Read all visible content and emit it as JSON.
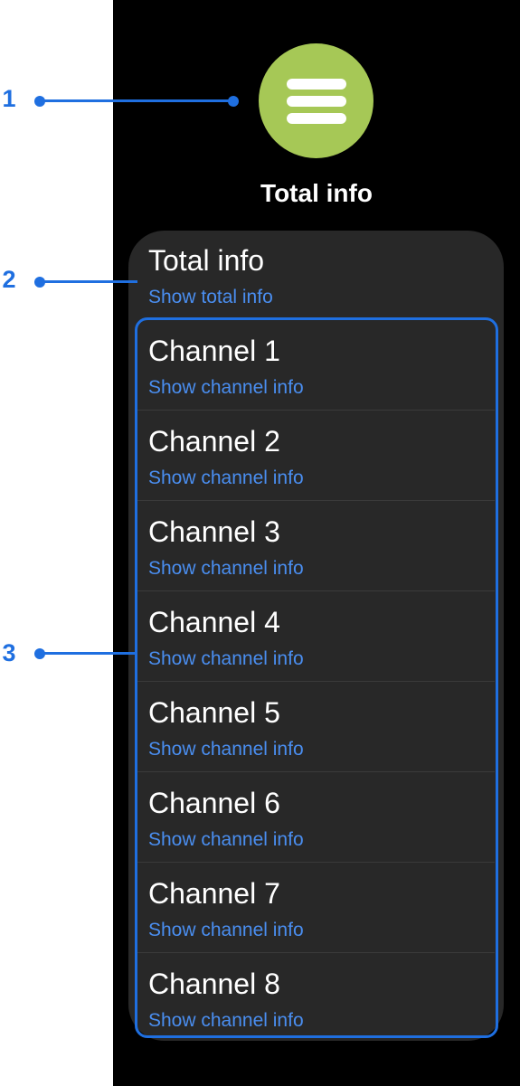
{
  "header": {
    "app_icon": "menu-icon",
    "app_icon_color": "#a6c856",
    "title": "Total info"
  },
  "list": {
    "total": {
      "title": "Total info",
      "subtitle": "Show total info"
    },
    "channels": [
      {
        "title": "Channel 1",
        "subtitle": "Show channel info"
      },
      {
        "title": "Channel 2",
        "subtitle": "Show channel info"
      },
      {
        "title": "Channel 3",
        "subtitle": "Show channel info"
      },
      {
        "title": "Channel 4",
        "subtitle": "Show channel info"
      },
      {
        "title": "Channel 5",
        "subtitle": "Show channel info"
      },
      {
        "title": "Channel 6",
        "subtitle": "Show channel info"
      },
      {
        "title": "Channel 7",
        "subtitle": "Show channel info"
      },
      {
        "title": "Channel 8",
        "subtitle": "Show channel info"
      }
    ]
  },
  "callouts": [
    "1",
    "2",
    "3"
  ],
  "colors": {
    "accent": "#4a8ef0",
    "annotation": "#1f6fe0",
    "background": "#000000",
    "card": "#282828"
  }
}
